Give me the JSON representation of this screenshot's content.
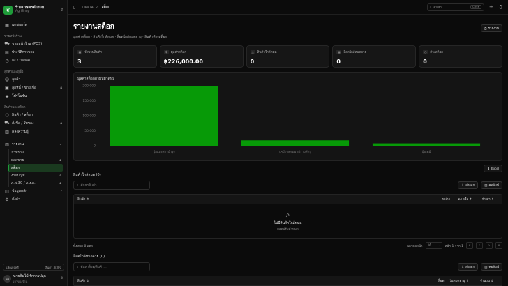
{
  "brand": {
    "name": "ร้านเกษตรตำรวย",
    "sub": "AgriShop"
  },
  "nav": {
    "dashboard": "แดชบอร์ด",
    "group_sales": "ขายหน้าร้าน",
    "pos": "ขายหน้าร้าน (POS)",
    "history": "ประวัติการขาย",
    "shift": "กะ / ปิดยอด",
    "group_customers": "ลูกค้าและผู้ซื้อ",
    "customers": "ลูกค้า",
    "debtors": "ลูกหนี้ / ขายเชื่อ",
    "promotions": "โปรโมชัน",
    "group_stock": "สินค้าและสต็อก",
    "products": "สินค้า / สต็อก",
    "purchase": "สั่งซื้อ / รับของ",
    "pricing": "คลังความรู้",
    "reports": "รายงาน",
    "rep_overview": "ภาพรวม",
    "rep_sales": "ยอดขาย",
    "rep_stock": "สต็อก",
    "rep_finance": "งานบัญชี",
    "rep_tax": "ภ.พ.30 / ภ.ง.ด.",
    "masterdata": "ข้อมูลหลัก",
    "settings": "ตั้งค่า"
  },
  "footer": {
    "plan_left": "แพ็กเกจฟรี",
    "plan_right": "สินค้า 3/300",
    "avatar": "นป",
    "user_name": "นายต้นไม้ รักการปลูก",
    "user_role": "เจ้าของร้าน"
  },
  "topbar": {
    "crumb_root": "รายงาน",
    "crumb_sep": ">",
    "crumb_current": "สต็อก",
    "search_placeholder": "ค้นหา...",
    "kbd": "Ctrl K"
  },
  "page": {
    "title": "รายงานสต็อก",
    "subtitle": "มูลค่าสต็อก · สินค้าใกล้หมด · ล็อตใกล้หมดอายุ · สินค้าค้างสต็อก",
    "export_label": "รายงาน"
  },
  "stats": [
    {
      "label": "จำนวนสินค้า",
      "value": "3",
      "icon": "box-icon"
    },
    {
      "label": "มูลค่าสต็อก",
      "value": "฿226,000.00",
      "icon": "money-icon"
    },
    {
      "label": "สินค้าใกล้หมด",
      "value": "0",
      "icon": "alert-icon"
    },
    {
      "label": "ล็อตใกล้หมดอายุ",
      "value": "0",
      "icon": "calendar-icon"
    },
    {
      "label": "ค้างสต็อก",
      "value": "0",
      "icon": "clock-icon"
    }
  ],
  "chart_title": "มูลค่าสต็อกตามหมวดหมู่",
  "chart_data": {
    "type": "bar",
    "categories": [
      "ปุ๋ยและสารบำรุง",
      "เคมีเกษตร/ยาปราบศัตรู",
      "ปุ๋ยเคมี"
    ],
    "values": [
      200000,
      18000,
      8000
    ],
    "ylim": [
      0,
      200000
    ],
    "yticks": [
      "0",
      "50,000",
      "100,000",
      "150,000",
      "200,000"
    ],
    "color": "#079a07",
    "grid": false
  },
  "excel_label": "Excel",
  "low_stock": {
    "title": "สินค้าใกล้หมด (0)",
    "search_placeholder": "ค้นหาสินค้า...",
    "btn_export": "ส่งออก",
    "btn_columns": "คอลัมน์",
    "cols": [
      "สินค้า",
      "หน่วย",
      "คงเหลือ",
      "ขั้นต่ำ"
    ],
    "empty_title": "ไม่มีสินค้าใกล้หมด",
    "empty_sub": "ยอดปรับตัวหมด",
    "pager_left": "ทั้งหมด 0 แถว",
    "rows_label": "แถวต่อหน้า",
    "rows_value": "10",
    "page_text": "หน้า 1 จาก 1"
  },
  "expiring": {
    "title": "ล็อตใกล้หมดอายุ (0)",
    "search_placeholder": "ค้นหาล็อต/สินค้า...",
    "btn_export": "ส่งออก",
    "btn_columns": "คอลัมน์",
    "cols": [
      "สินค้า",
      "ล็อต",
      "วันหมดอายุ",
      "จำนวน"
    ]
  }
}
